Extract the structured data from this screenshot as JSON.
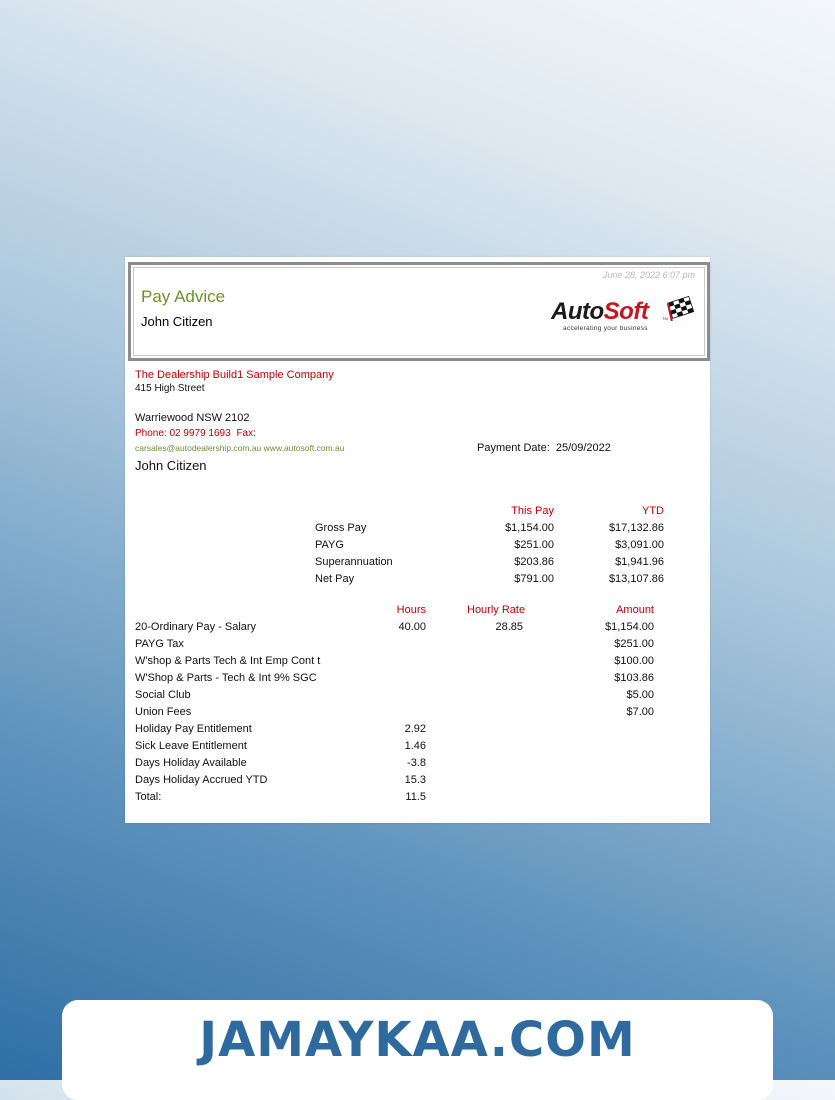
{
  "header": {
    "timestamp": "June 28, 2022 6:07 pm",
    "title": "Pay Advice",
    "employee": "John Citizen",
    "logo": {
      "brand_black": "Auto",
      "brand_red": "Soft",
      "tm": "TM",
      "tagline": "accelerating your business",
      "icon": "checkered-flag-icon"
    }
  },
  "company": {
    "name": "The Dealership Build1 Sample Company",
    "street": "415 High Street",
    "suburb": "Warriewood NSW 2102",
    "phone_label": "Phone:",
    "phone": "02 9979 1693",
    "fax_label": "Fax:",
    "web": "carsales@autodealership.com.au www.autosoft.com.au",
    "recipient": "John Citizen"
  },
  "payment": {
    "label": "Payment Date:",
    "date": "25/09/2022"
  },
  "summary": {
    "headers": {
      "this_pay": "This Pay",
      "ytd": "YTD"
    },
    "rows": [
      {
        "label": "Gross Pay",
        "this_pay": "$1,154.00",
        "ytd": "$17,132.86"
      },
      {
        "label": "PAYG",
        "this_pay": "$251.00",
        "ytd": "$3,091.00"
      },
      {
        "label": "Superannuation",
        "this_pay": "$203.86",
        "ytd": "$1,941.96"
      },
      {
        "label": "Net Pay",
        "this_pay": "$791.00",
        "ytd": "$13,107.86"
      }
    ]
  },
  "details": {
    "headers": {
      "hours": "Hours",
      "rate": "Hourly Rate",
      "amount": "Amount"
    },
    "rows": [
      {
        "label": "20-Ordinary Pay - Salary",
        "hours": "40.00",
        "rate": "28.85",
        "amount": "$1,154.00"
      },
      {
        "label": "PAYG Tax",
        "hours": "",
        "rate": "",
        "amount": "$251.00"
      },
      {
        "label": "W'shop & Parts Tech & Int Emp Cont t",
        "hours": "",
        "rate": "",
        "amount": "$100.00"
      },
      {
        "label": "W'Shop & Parts - Tech & Int 9% SGC",
        "hours": "",
        "rate": "",
        "amount": "$103.86"
      },
      {
        "label": "Social Club",
        "hours": "",
        "rate": "",
        "amount": "$5.00"
      },
      {
        "label": "Union Fees",
        "hours": "",
        "rate": "",
        "amount": "$7.00"
      },
      {
        "label": "Holiday Pay Entitlement",
        "hours": "2.92",
        "rate": "",
        "amount": ""
      },
      {
        "label": "Sick Leave Entitlement",
        "hours": "1.46",
        "rate": "",
        "amount": ""
      },
      {
        "label": "Days Holiday Available",
        "hours": "-3.8",
        "rate": "",
        "amount": ""
      },
      {
        "label": "Days Holiday Accrued YTD",
        "hours": "15.3",
        "rate": "",
        "amount": ""
      },
      {
        "label": "Total:",
        "hours": "11.5",
        "rate": "",
        "amount": ""
      }
    ]
  },
  "watermark": "JAMAYKAA.COM"
}
